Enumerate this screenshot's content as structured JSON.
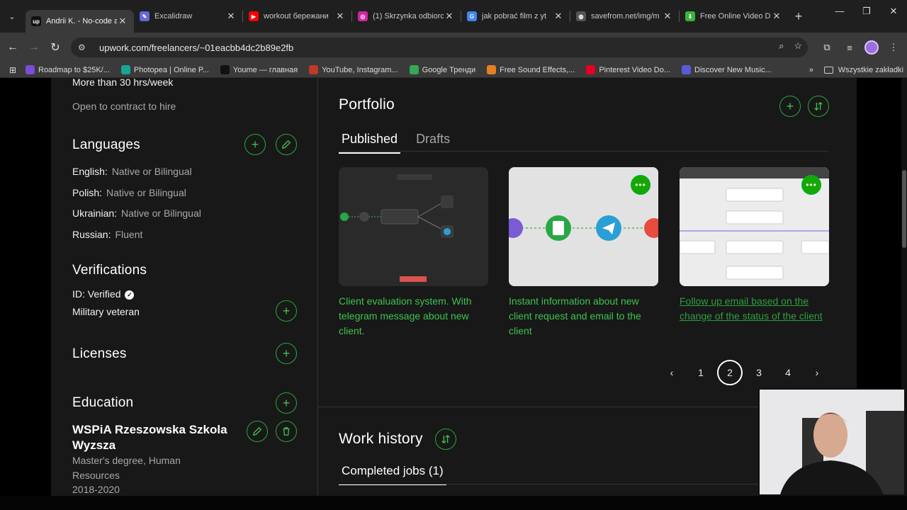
{
  "browser": {
    "tabs": [
      {
        "title": "Andrii K. - No-code a",
        "fav_color": "#111111",
        "fav_text": "up",
        "active": true
      },
      {
        "title": "Excalidraw",
        "fav_color": "#6965db",
        "fav_text": "✎",
        "active": false
      },
      {
        "title": "workout бережани",
        "fav_color": "#ff0000",
        "fav_text": "▶",
        "active": false
      },
      {
        "title": "(1) Skrzynka odbiorc",
        "fav_color": "#d6249f",
        "fav_text": "◎",
        "active": false
      },
      {
        "title": "jak pobrać film z yt",
        "fav_color": "#4285f4",
        "fav_text": "G",
        "active": false
      },
      {
        "title": "savefrom.net/img/m",
        "fav_color": "#555555",
        "fav_text": "◍",
        "active": false
      },
      {
        "title": "Free Online Video Do",
        "fav_color": "#3bb33b",
        "fav_text": "⬇",
        "active": false
      }
    ],
    "url": "upwork.com/freelancers/~01eacbb4dc2b89e2fb",
    "bookmarks": [
      {
        "label": "Roadmap to $25K/...",
        "color": "#7b4cd6"
      },
      {
        "label": "Photopea | Online P...",
        "color": "#18a497"
      },
      {
        "label": "Youme — главная",
        "color": "#111111"
      },
      {
        "label": "YouTube, Instagram...",
        "color": "#c0392b"
      },
      {
        "label": "Google Тренди",
        "color": "#34a853"
      },
      {
        "label": "Free Sound Effects,...",
        "color": "#e67e22"
      },
      {
        "label": "Pinterest Video Do...",
        "color": "#e60023"
      },
      {
        "label": "Discover New Music...",
        "color": "#5b5bd6"
      }
    ],
    "bookmarks_all": "Wszystkie zakładki"
  },
  "sidebar": {
    "hours": "More than 30 hrs/week",
    "contract": "Open to contract to hire",
    "languages_title": "Languages",
    "languages": [
      {
        "name": "English:",
        "level": "Native or Bilingual"
      },
      {
        "name": "Polish:",
        "level": "Native or Bilingual"
      },
      {
        "name": "Ukrainian:",
        "level": "Native or Bilingual"
      },
      {
        "name": "Russian:",
        "level": "Fluent"
      }
    ],
    "verifications_title": "Verifications",
    "id_verified": "ID: Verified",
    "military": "Military veteran",
    "licenses_title": "Licenses",
    "education_title": "Education",
    "school": "WSPiA Rzeszowska Szkola Wyzsza",
    "degree": "Master's degree, Human Resources",
    "years": "2018-2020"
  },
  "portfolio": {
    "title": "Portfolio",
    "tabs": [
      "Published",
      "Drafts"
    ],
    "items": [
      {
        "title": "Client evaluation system. With telegram message about new client.",
        "link": false
      },
      {
        "title": "Instant information about new client request and email to the client",
        "link": false
      },
      {
        "title": "Follow up email based on the change of the status of the client",
        "link": true
      }
    ],
    "pages": [
      "1",
      "2",
      "3",
      "4"
    ],
    "current_page": "2"
  },
  "work_history": {
    "title": "Work history",
    "tab": "Completed jobs (1)"
  },
  "colors": {
    "accent": "#14a800",
    "accent_text": "#3ec24f",
    "card_bg": "#181818"
  }
}
